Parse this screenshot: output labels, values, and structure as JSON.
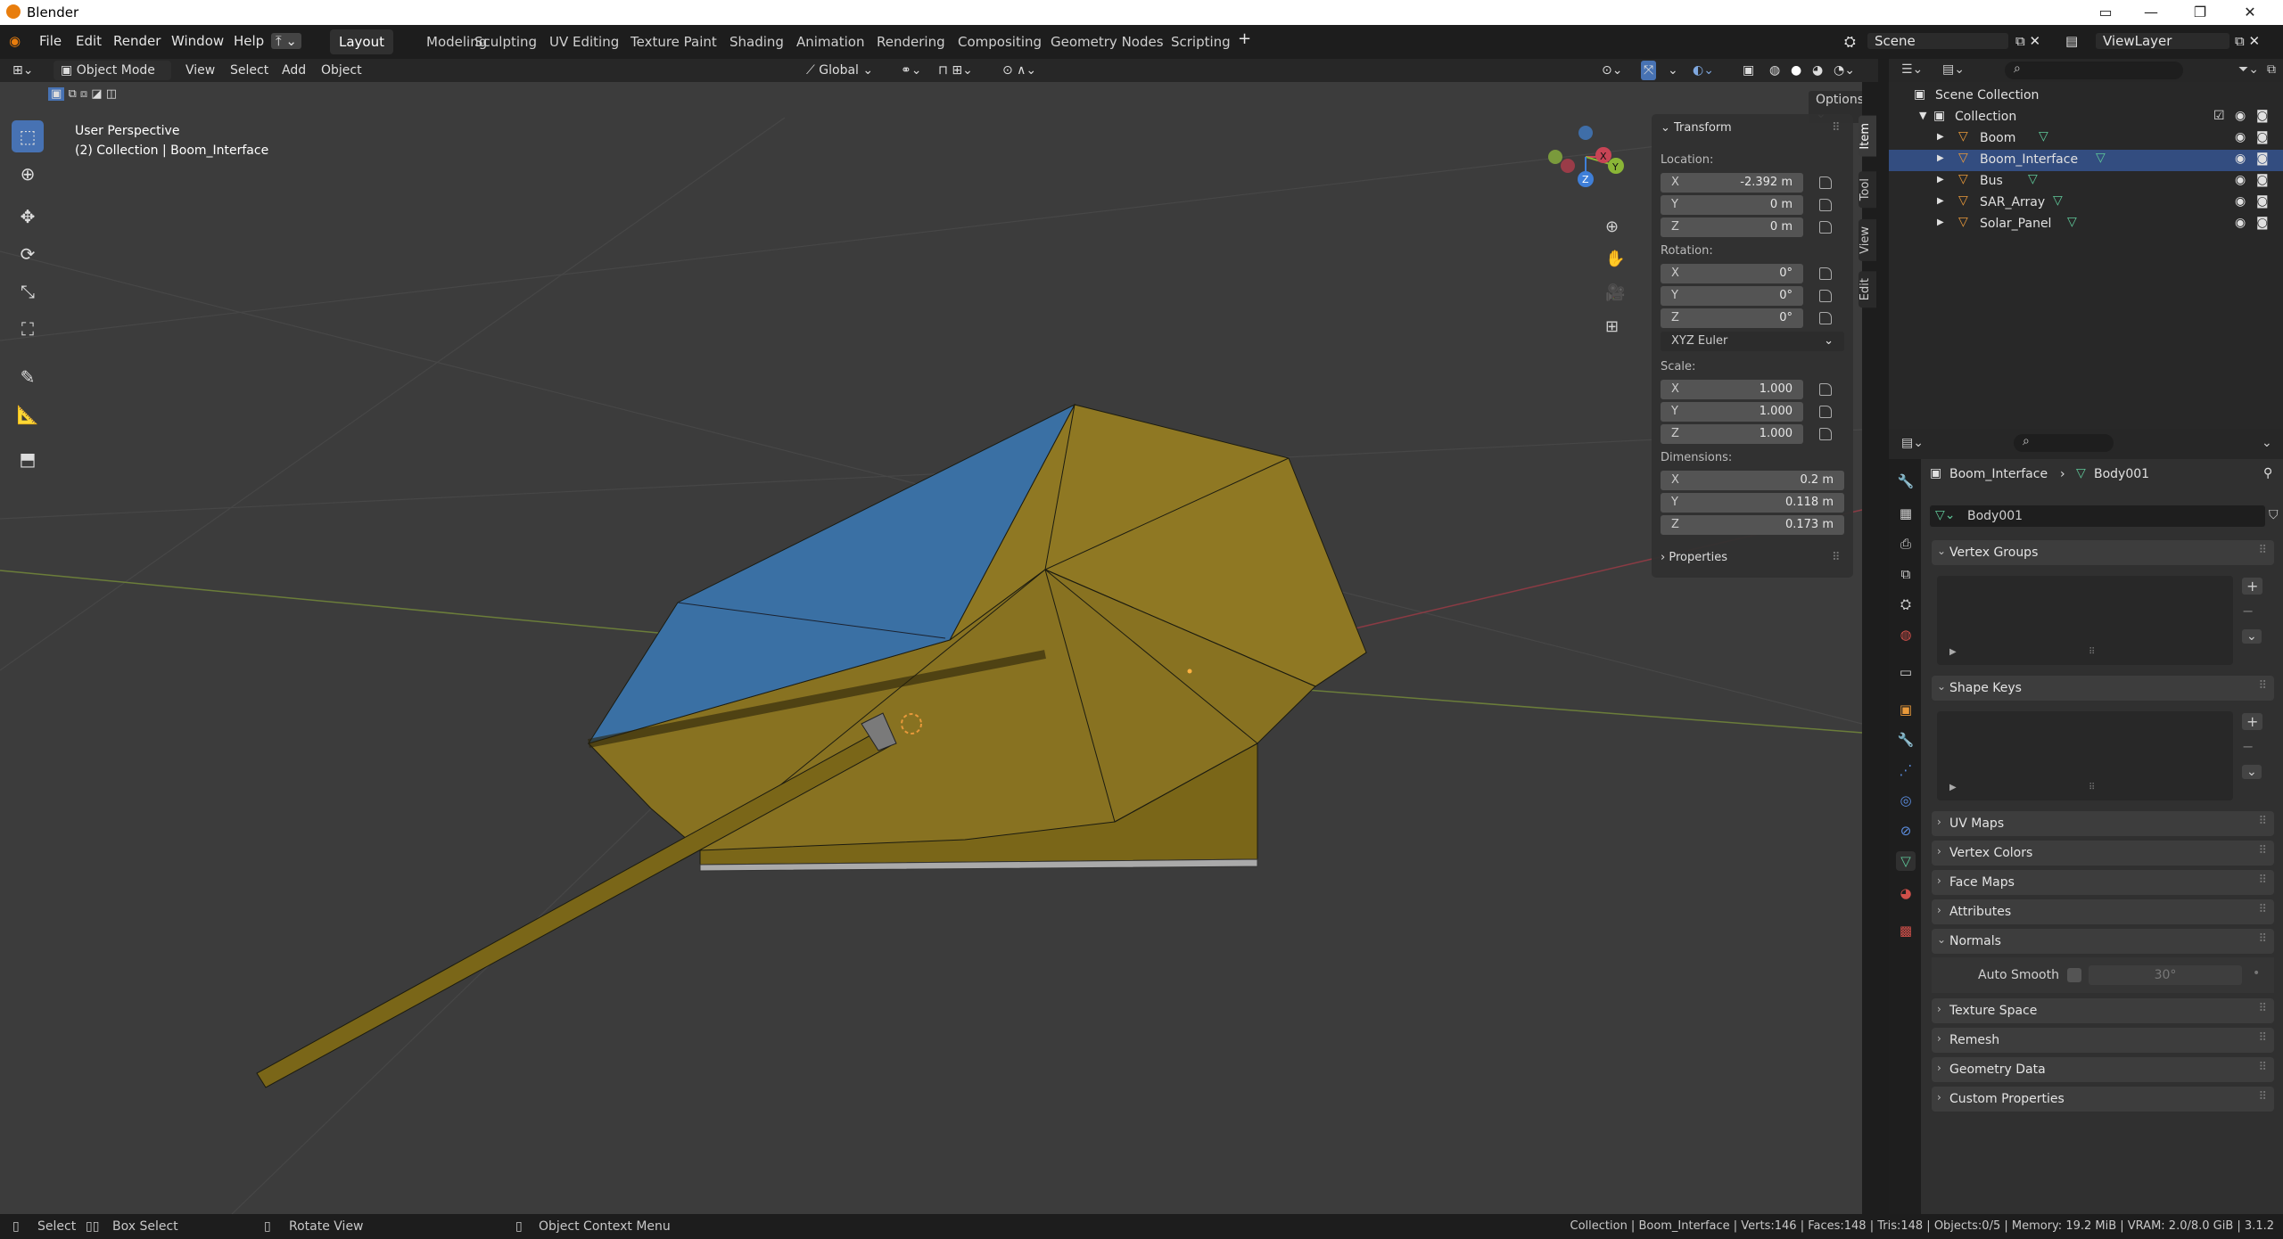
{
  "window": {
    "title": "Blender",
    "controls": [
      "—",
      "❐",
      "✕"
    ]
  },
  "menus": [
    "File",
    "Edit",
    "Render",
    "Window",
    "Help"
  ],
  "workspaces": [
    "Layout",
    "Modeling",
    "Sculpting",
    "UV Editing",
    "Texture Paint",
    "Shading",
    "Animation",
    "Rendering",
    "Compositing",
    "Geometry Nodes",
    "Scripting"
  ],
  "active_workspace": "Layout",
  "scene": {
    "name": "Scene",
    "view_layer": "ViewLayer"
  },
  "viewport_header": {
    "mode": "Object Mode",
    "menus": [
      "View",
      "Select",
      "Add",
      "Object"
    ],
    "transform_orientation": "Global",
    "options_label": "Options"
  },
  "viewport": {
    "view_name": "User Perspective",
    "collection_info": "(2) Collection | Boom_Interface",
    "gizmo_axes": [
      "X",
      "Y",
      "Z"
    ]
  },
  "n_panel": {
    "tabs": [
      "Item",
      "Tool",
      "View",
      "Edit"
    ],
    "transform_title": "Transform",
    "location_label": "Location:",
    "location": [
      {
        "axis": "X",
        "value": "-2.392 m"
      },
      {
        "axis": "Y",
        "value": "0 m"
      },
      {
        "axis": "Z",
        "value": "0 m"
      }
    ],
    "rotation_label": "Rotation:",
    "rotation": [
      {
        "axis": "X",
        "value": "0°"
      },
      {
        "axis": "Y",
        "value": "0°"
      },
      {
        "axis": "Z",
        "value": "0°"
      }
    ],
    "rotation_mode": "XYZ Euler",
    "scale_label": "Scale:",
    "scale": [
      {
        "axis": "X",
        "value": "1.000"
      },
      {
        "axis": "Y",
        "value": "1.000"
      },
      {
        "axis": "Z",
        "value": "1.000"
      }
    ],
    "dimensions_label": "Dimensions:",
    "dimensions": [
      {
        "axis": "X",
        "value": "0.2 m"
      },
      {
        "axis": "Y",
        "value": "0.118 m"
      },
      {
        "axis": "Z",
        "value": "0.173 m"
      }
    ],
    "properties_label": "Properties"
  },
  "outliner": {
    "root": "Scene Collection",
    "collection": "Collection",
    "objects": [
      "Boom",
      "Boom_Interface",
      "Bus",
      "SAR_Array",
      "Solar_Panel"
    ]
  },
  "properties": {
    "breadcrumb_object": "Boom_Interface",
    "breadcrumb_data": "Body001",
    "mesh_name": "Body001",
    "panels": [
      {
        "label": "Vertex Groups",
        "open": true
      },
      {
        "label": "Shape Keys",
        "open": true
      },
      {
        "label": "UV Maps",
        "open": false
      },
      {
        "label": "Vertex Colors",
        "open": false
      },
      {
        "label": "Face Maps",
        "open": false
      },
      {
        "label": "Attributes",
        "open": false
      },
      {
        "label": "Normals",
        "open": true
      },
      {
        "label": "Texture Space",
        "open": false
      },
      {
        "label": "Remesh",
        "open": false
      },
      {
        "label": "Geometry Data",
        "open": false
      },
      {
        "label": "Custom Properties",
        "open": false
      }
    ],
    "auto_smooth_label": "Auto Smooth",
    "auto_smooth_angle": "30°"
  },
  "statusbar": {
    "select": "Select",
    "box_select": "Box Select",
    "rotate_view": "Rotate View",
    "context_menu": "Object Context Menu",
    "stats": "Collection | Boom_Interface | Verts:146 | Faces:148 | Tris:148 | Objects:0/5 | Memory: 19.2 MiB | VRAM: 2.0/8.0 GiB | 3.1.2"
  },
  "colors": {
    "accent": "#4772b3",
    "face_yellow": "#8a7420",
    "face_blue": "#3b6ea0",
    "mesh_icon": "#5fc99a",
    "object_icon": "#e8993a"
  }
}
